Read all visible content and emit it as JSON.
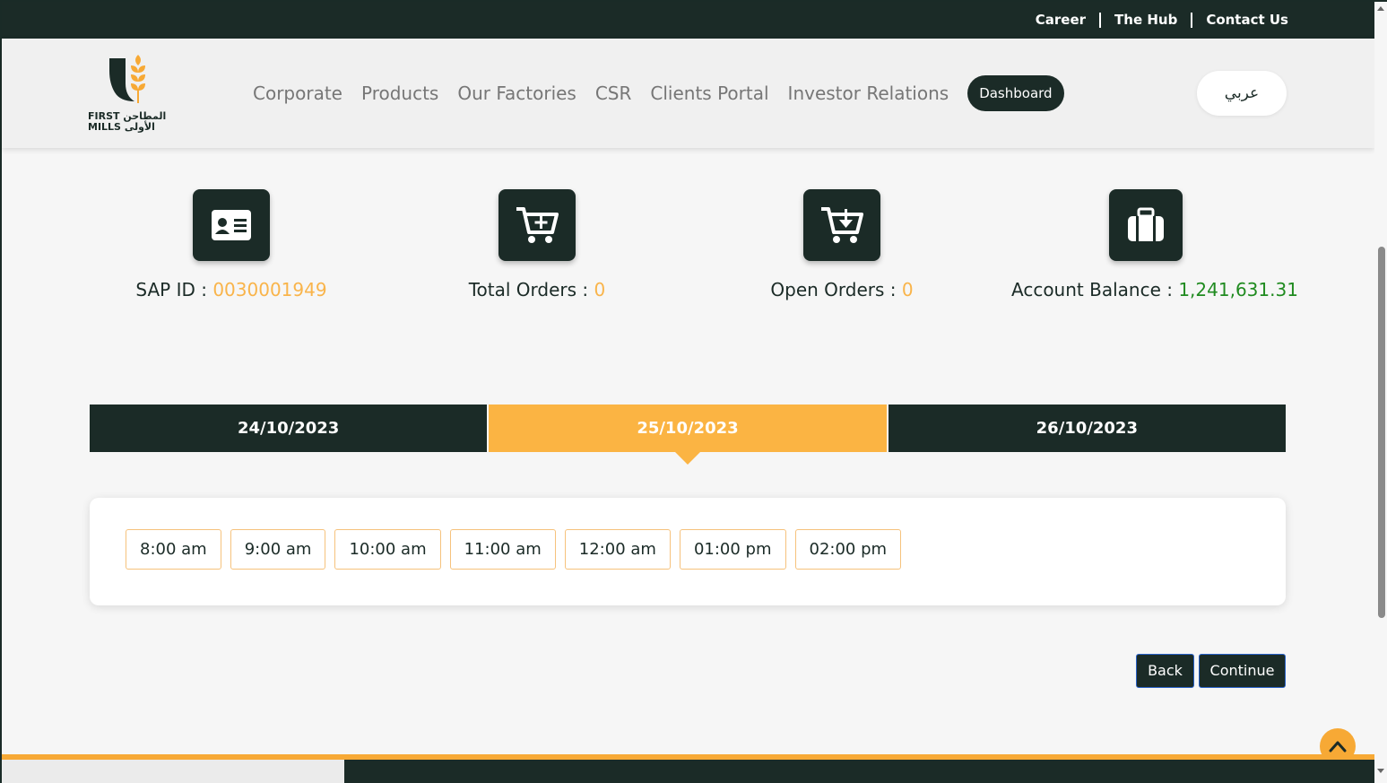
{
  "topbar": {
    "links": [
      "Career",
      "The Hub",
      "Contact Us"
    ]
  },
  "logo": {
    "line1": "FIRST المطاحن",
    "line2": "MILLS الأولى"
  },
  "nav": {
    "items": [
      "Corporate",
      "Products",
      "Our Factories",
      "CSR",
      "Clients Portal",
      "Investor Relations"
    ],
    "dashboard": "Dashboard",
    "language": "عربي"
  },
  "stats": [
    {
      "label": "SAP ID : ",
      "value": "0030001949",
      "icon": "id-card-icon"
    },
    {
      "label": "Total Orders : ",
      "value": "0",
      "icon": "cart-plus-icon"
    },
    {
      "label": "Open Orders : ",
      "value": "0",
      "icon": "cart-down-icon"
    },
    {
      "label": "Account Balance : ",
      "value": "1,241,631.31",
      "icon": "briefcase-icon"
    }
  ],
  "dates": [
    "24/10/2023",
    "25/10/2023",
    "26/10/2023"
  ],
  "selected_date": "25/10/2023",
  "slots": [
    "8:00 am",
    "9:00 am",
    "10:00 am",
    "11:00 am",
    "12:00 am",
    "01:00 pm",
    "02:00 pm"
  ],
  "actions": {
    "back": "Back",
    "continue": "Continue"
  },
  "colors": {
    "primary": "#1b2b27",
    "accent": "#fbb443",
    "positive": "#208b20"
  }
}
